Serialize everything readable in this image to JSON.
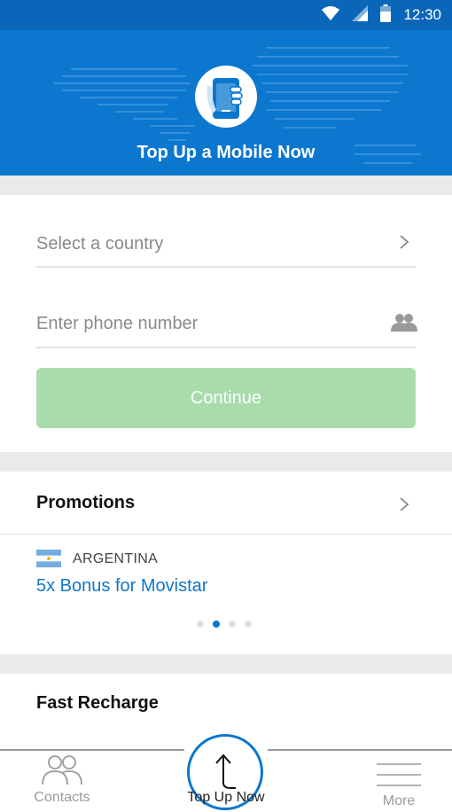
{
  "status_bar": {
    "time": "12:30",
    "icons": [
      "wifi-icon",
      "signal-icon",
      "battery-icon"
    ]
  },
  "header": {
    "title": "Top Up a Mobile Now",
    "logo": "phone-hand-logo-icon"
  },
  "form": {
    "country_placeholder": "Select a country",
    "phone_placeholder": "Enter phone number",
    "continue_label": "Continue"
  },
  "promotions": {
    "title": "Promotions",
    "items": [
      {
        "country": "ARGENTINA",
        "text": "5x Bonus for Movistar",
        "flag": "argentina-flag-icon"
      }
    ],
    "pager": {
      "count": 4,
      "active_index": 1
    }
  },
  "fast_recharge": {
    "title": "Fast Recharge"
  },
  "bottom_nav": {
    "contacts_label": "Contacts",
    "top_up_label": "Top Up Now",
    "more_label": "More"
  },
  "colors": {
    "brand_blue": "#0b77cf",
    "continue_green": "#a9dbab",
    "link_blue": "#1077c8"
  }
}
